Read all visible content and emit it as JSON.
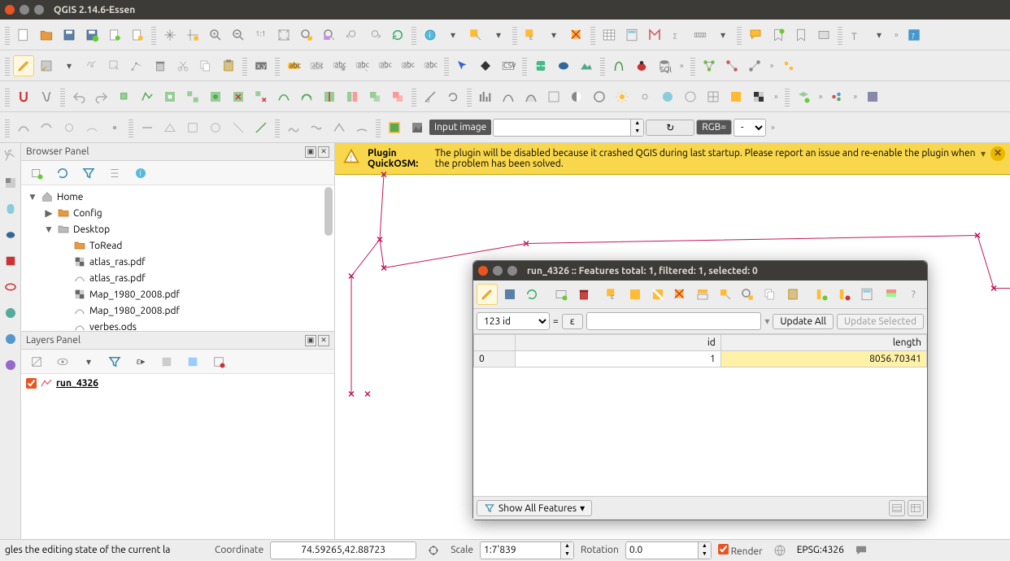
{
  "window": {
    "title": "QGIS 2.14.6-Essen"
  },
  "warning": {
    "prefix": "Plugin QuickOSM:",
    "text": " The plugin will be disabled because it crashed QGIS during last startup. Please report an issue and re-enable the plugin when the problem has been solved."
  },
  "input_image_label": "Input image",
  "rgb_label": "RGB=",
  "rgb_value": "-",
  "browser_panel": {
    "title": "Browser Panel",
    "tree": [
      {
        "arrow": "▼",
        "icon": "home",
        "label": "Home",
        "indent": 0
      },
      {
        "arrow": "▶",
        "icon": "folder",
        "label": "Config",
        "indent": 1
      },
      {
        "arrow": "▼",
        "icon": "folder-gray",
        "label": "Desktop",
        "indent": 1
      },
      {
        "arrow": "",
        "icon": "folder",
        "label": "ToRead",
        "indent": 2
      },
      {
        "arrow": "",
        "icon": "raster",
        "label": "atlas_ras.pdf",
        "indent": 2
      },
      {
        "arrow": "",
        "icon": "vector",
        "label": "atlas_ras.pdf",
        "indent": 2
      },
      {
        "arrow": "",
        "icon": "raster",
        "label": "Map_1980_2008.pdf",
        "indent": 2
      },
      {
        "arrow": "",
        "icon": "vector",
        "label": "Map_1980_2008.pdf",
        "indent": 2
      },
      {
        "arrow": "",
        "icon": "vector",
        "label": "verbes.ods",
        "indent": 2
      }
    ]
  },
  "layers_panel": {
    "title": "Layers Panel",
    "layers": [
      {
        "checked": true,
        "name": "run_4326"
      }
    ]
  },
  "attr_window": {
    "title": "run_4326 :: Features total: 1, filtered: 1, selected: 0",
    "field": "123 id",
    "eq": "=",
    "eps_btn": "ε",
    "update_all": "Update All",
    "update_selected": "Update Selected",
    "cols": [
      "id",
      "length"
    ],
    "rows": [
      {
        "rownum": "0",
        "id": "1",
        "length": "8056.70341"
      }
    ],
    "show_all": "Show All Features"
  },
  "statusbar": {
    "tip": "gles the editing state of the current la",
    "coord_label": "Coordinate",
    "coord": "74.59265,42.88723",
    "scale_label": "Scale",
    "scale": "1:7'839",
    "rot_label": "Rotation",
    "rot": "0.0",
    "render": "Render",
    "crs": "EPSG:4326"
  }
}
